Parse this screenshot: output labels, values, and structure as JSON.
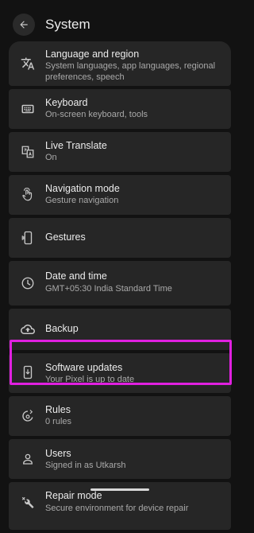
{
  "header": {
    "title": "System",
    "back_icon": "arrow-left-icon"
  },
  "items": [
    {
      "title": "Language and region",
      "subtitle": "System languages, app languages, regional preferences, speech",
      "icon": "translate-icon"
    },
    {
      "title": "Keyboard",
      "subtitle": "On-screen keyboard, tools",
      "icon": "keyboard-icon"
    },
    {
      "title": "Live Translate",
      "subtitle": "On",
      "icon": "live-translate-icon"
    },
    {
      "title": "Navigation mode",
      "subtitle": "Gesture navigation",
      "icon": "gesture-hand-icon"
    },
    {
      "title": "Gestures",
      "subtitle": "",
      "icon": "phone-gesture-icon"
    },
    {
      "title": "Date and time",
      "subtitle": "GMT+05:30 India Standard Time",
      "icon": "clock-icon"
    },
    {
      "title": "Backup",
      "subtitle": "",
      "icon": "cloud-upload-icon"
    },
    {
      "title": "Software updates",
      "subtitle": "Your Pixel is up to date",
      "icon": "system-update-icon"
    },
    {
      "title": "Rules",
      "subtitle": "0 rules",
      "icon": "rules-icon"
    },
    {
      "title": "Users",
      "subtitle": "Signed in as Utkarsh",
      "icon": "person-icon"
    },
    {
      "title": "Repair mode",
      "subtitle": "Secure environment for device repair",
      "icon": "repair-tools-icon"
    }
  ],
  "colors": {
    "background": "#121212",
    "card": "#262626",
    "highlight": "#e020e0"
  }
}
